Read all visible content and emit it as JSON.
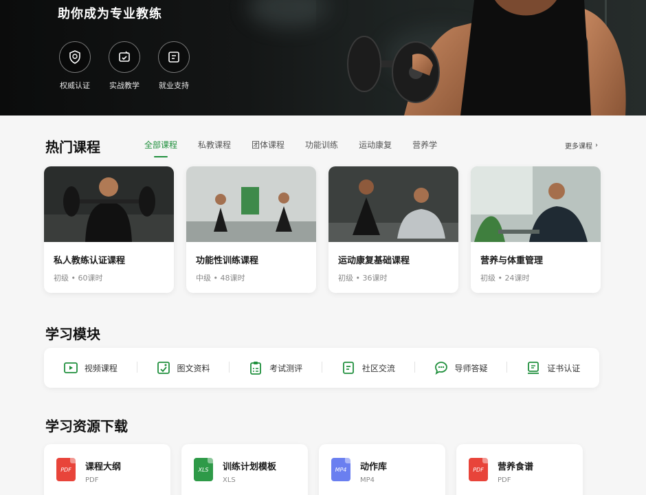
{
  "hero": {
    "subtitle": "助你成为专业教练",
    "features": [
      {
        "label": "权威认证",
        "icon": "certified-badge-icon"
      },
      {
        "label": "实战教学",
        "icon": "practice-teaching-icon"
      },
      {
        "label": "就业支持",
        "icon": "career-support-icon"
      }
    ]
  },
  "courses": {
    "title": "热门课程",
    "tabs": [
      "全部课程",
      "私教课程",
      "团体课程",
      "功能训练",
      "运动康复",
      "营养学"
    ],
    "active_tab": "全部课程",
    "more_label": "更多课程",
    "items": [
      {
        "name": "私人教练认证课程",
        "meta": "初级 • 60课时"
      },
      {
        "name": "功能性训练课程",
        "meta": "中级 • 48课时"
      },
      {
        "name": "运动康复基础课程",
        "meta": "初级 • 36课时"
      },
      {
        "name": "营养与体重管理",
        "meta": "初级 • 24课时"
      }
    ]
  },
  "modules": {
    "title": "学习模块",
    "items": [
      {
        "label": "视频课程",
        "icon": "video-play-icon"
      },
      {
        "label": "图文资料",
        "icon": "image-doc-icon"
      },
      {
        "label": "考试测评",
        "icon": "exam-clipboard-icon"
      },
      {
        "label": "社区交流",
        "icon": "community-chat-icon"
      },
      {
        "label": "导师答疑",
        "icon": "tutor-chat-icon"
      },
      {
        "label": "证书认证",
        "icon": "certificate-icon"
      }
    ]
  },
  "resources": {
    "title": "学习资源下载",
    "items": [
      {
        "name": "课程大纲",
        "type": "PDF",
        "color": "#e8443a"
      },
      {
        "name": "训练计划模板",
        "type": "XLS",
        "color": "#2e9a48"
      },
      {
        "name": "动作库",
        "type": "MP4",
        "color": "#6a7ff0"
      },
      {
        "name": "营养食谱",
        "type": "PDF",
        "color": "#e8443a"
      }
    ]
  },
  "colors": {
    "accent": "#1f8f3c",
    "hero_bg": "#0b0c0c"
  }
}
